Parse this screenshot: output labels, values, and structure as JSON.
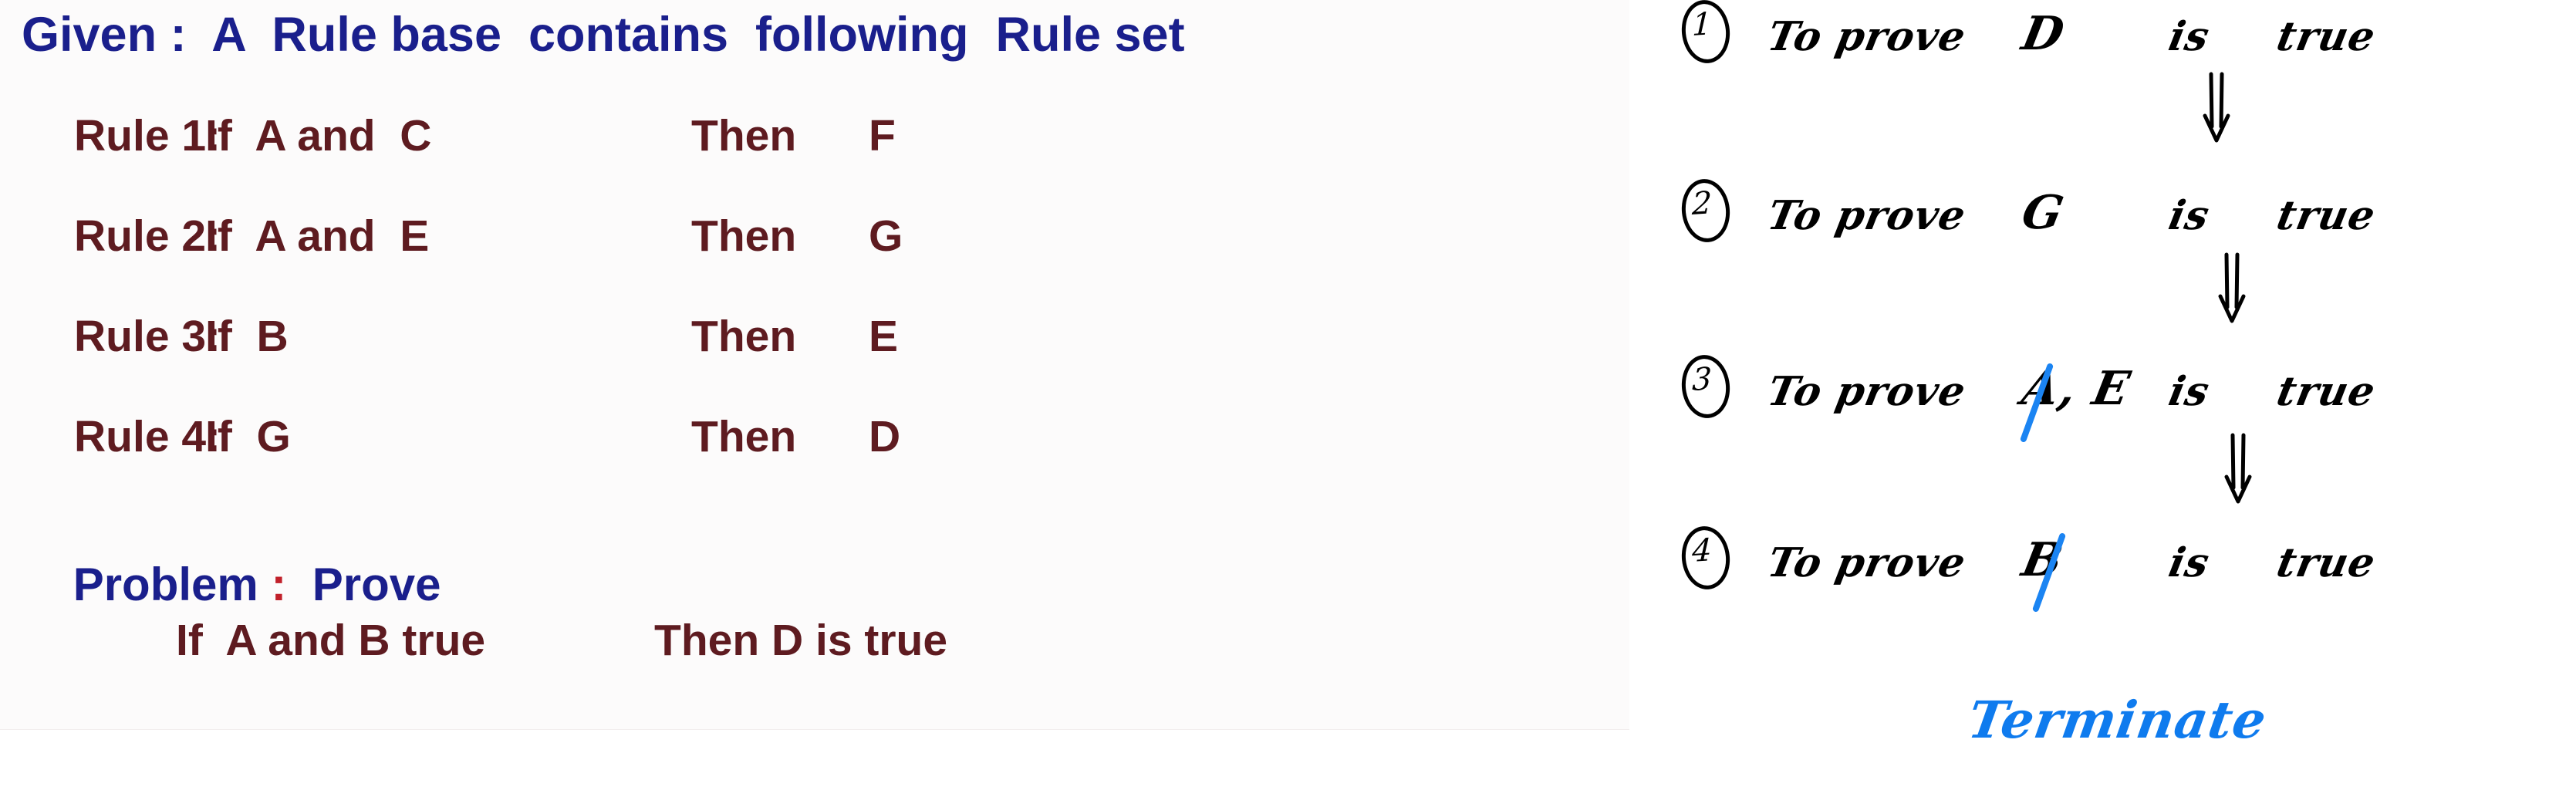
{
  "slide": {
    "heading": "Given :  A  Rule base  contains  following  Rule set",
    "rules": [
      {
        "label": "Rule 1:",
        "antecedent": "If  A and  C",
        "then": "Then",
        "consequent": "F"
      },
      {
        "label": "Rule 2:",
        "antecedent": "If  A and  E",
        "then": "Then",
        "consequent": "G"
      },
      {
        "label": "Rule 3:",
        "antecedent": "If  B",
        "then": "Then",
        "consequent": "E"
      },
      {
        "label": "Rule 4:",
        "antecedent": "If  G",
        "then": "Then",
        "consequent": "D"
      }
    ],
    "problem": {
      "word": "Problem",
      "colon": ":",
      "verb": "Prove",
      "goal_if": "If  A and B true",
      "goal_then": "Then D is true"
    }
  },
  "annotation": {
    "steps": [
      {
        "number": "1",
        "to_prove": "To prove",
        "subject": "D",
        "is": "is",
        "true": "true",
        "struck": false
      },
      {
        "number": "2",
        "to_prove": "To prove",
        "subject": "G",
        "is": "is",
        "true": "true",
        "struck": false
      },
      {
        "number": "3",
        "to_prove": "To prove",
        "subject": "A, E",
        "is": "is",
        "true": "true",
        "struck": true
      },
      {
        "number": "4",
        "to_prove": "To prove",
        "subject": "B",
        "is": "is",
        "true": "true",
        "struck": true
      }
    ],
    "arrow_glyph": "double-down-arrow",
    "terminate": "Terminate"
  },
  "colors": {
    "heading_blue": "#1a1f8c",
    "rule_maroon": "#5e1b20",
    "colon_red": "#c1202a",
    "ink_black": "#000000",
    "ink_blue": "#1b84f2",
    "terminate_blue": "#0f7bee",
    "slide_bg": "#fcfbfb",
    "page_bg": "#ffffff"
  }
}
